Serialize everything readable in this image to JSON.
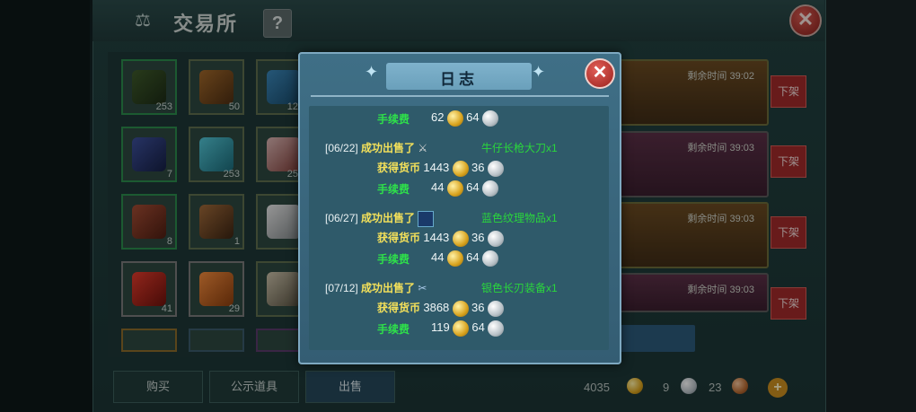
{
  "window": {
    "title": "交易所",
    "help_label": "?",
    "close_label": "✕"
  },
  "inventory": {
    "slots": [
      {
        "count": "253"
      },
      {
        "count": "50"
      },
      {
        "count": "12"
      },
      {
        "count": "7"
      },
      {
        "count": "253"
      },
      {
        "count": "25"
      },
      {
        "count": "8"
      },
      {
        "count": "1"
      },
      {
        "count": ""
      },
      {
        "count": "41"
      },
      {
        "count": "29"
      },
      {
        "count": ""
      }
    ]
  },
  "listings": [
    {
      "time": "剩余时间  39:02",
      "off_label": "下架"
    },
    {
      "time": "剩余时间  39:03",
      "off_label": "下架"
    },
    {
      "time": "剩余时间  39:03",
      "off_label": "下架"
    },
    {
      "time": "剩余时间  39:03",
      "off_label": "下架"
    }
  ],
  "tabs": {
    "buy": "购买",
    "display": "公示道具",
    "sell": "出售"
  },
  "currency": {
    "gold": "4035",
    "silver": "9",
    "copper": "23",
    "add": "+"
  },
  "modal": {
    "title": "日志",
    "close_label": "✕",
    "entries": [
      {
        "fee_label": "手续费",
        "fee_gold": "62",
        "fee_silver": "64"
      },
      {
        "date": "[06/22]",
        "action": "成功出售了",
        "item": "牛仔长枪大刀x1",
        "earn_label": "获得货币",
        "earn_gold": "1443",
        "earn_silver": "36",
        "fee_label": "手续费",
        "fee_gold": "44",
        "fee_silver": "64"
      },
      {
        "date": "[06/27]",
        "action": "成功出售了",
        "item": "蓝色纹理物品x1",
        "earn_label": "获得货币",
        "earn_gold": "1443",
        "earn_silver": "36",
        "fee_label": "手续费",
        "fee_gold": "44",
        "fee_silver": "64"
      },
      {
        "date": "[07/12]",
        "action": "成功出售了",
        "item": "银色长刃装备x1",
        "earn_label": "获得货币",
        "earn_gold": "3868",
        "earn_silver": "36",
        "fee_label": "手续费",
        "fee_gold": "119",
        "fee_silver": "64"
      }
    ]
  }
}
